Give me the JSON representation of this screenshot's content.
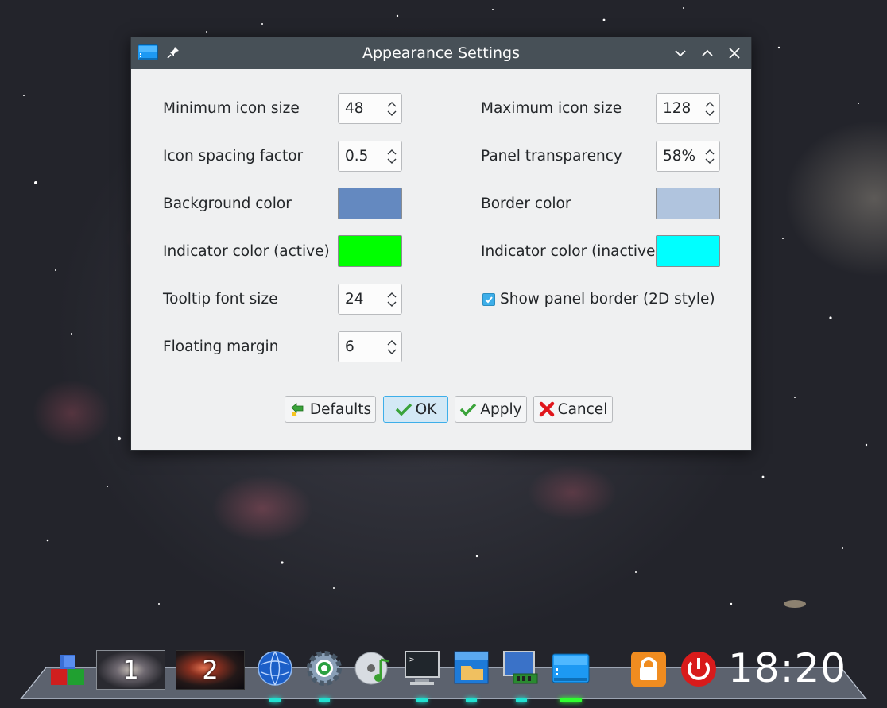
{
  "window": {
    "title": "Appearance Settings",
    "controls": [
      "minimize-icon",
      "maximize-icon",
      "close-icon"
    ]
  },
  "settings": {
    "min_icon_size": {
      "label": "Minimum icon size",
      "value": "48"
    },
    "max_icon_size": {
      "label": "Maximum icon size",
      "value": "128"
    },
    "icon_spacing": {
      "label": "Icon spacing factor",
      "value": "0.5"
    },
    "panel_transparency": {
      "label": "Panel transparency",
      "value": "58%"
    },
    "background_color": {
      "label": "Background color",
      "color": "#6489c0"
    },
    "border_color": {
      "label": "Border color",
      "color": "#b0c4de"
    },
    "indicator_active": {
      "label": "Indicator color (active)",
      "color": "#00ff00"
    },
    "indicator_inactive": {
      "label": "Indicator color (inactive)",
      "color": "#00ffff"
    },
    "tooltip_font_size": {
      "label": "Tooltip font size",
      "value": "24"
    },
    "show_panel_border": {
      "label": "Show panel border (2D style)",
      "checked": true
    },
    "floating_margin": {
      "label": "Floating margin",
      "value": "6"
    }
  },
  "buttons": {
    "defaults": "Defaults",
    "ok": "OK",
    "apply": "Apply",
    "cancel": "Cancel"
  },
  "dock": {
    "pager": [
      "1",
      "2"
    ],
    "items": [
      "launcher-cubes-icon",
      "browser-globe-icon",
      "settings-gear-icon",
      "media-player-icon",
      "terminal-icon",
      "file-manager-icon",
      "system-monitor-icon",
      "dock-settings-icon",
      "lock-icon",
      "power-icon"
    ],
    "clock": "18:20"
  },
  "colors": {
    "titlebar": "#475057",
    "dialog_bg": "#eff0f1",
    "accent": "#3daee9"
  }
}
